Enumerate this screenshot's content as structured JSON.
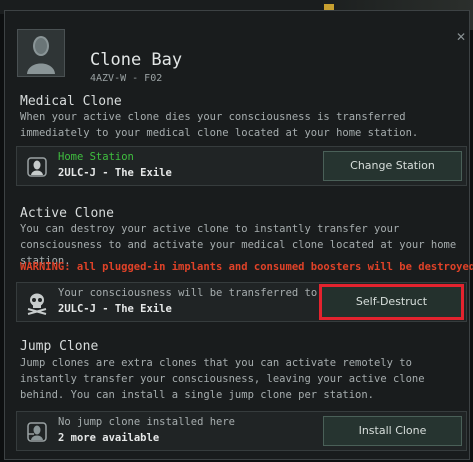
{
  "window": {
    "title": "Clone Bay",
    "subtitle": "4AZV-W - F02",
    "close_icon": "close-icon"
  },
  "medical": {
    "title": "Medical Clone",
    "description": "When your active clone dies your consciousness is transferred immediately to your medical clone located at your home station.",
    "home_label": "Home Station",
    "home_value": "2ULC-J - The Exile",
    "button": "Change Station",
    "accent": "#3fbf3f"
  },
  "active": {
    "title": "Active Clone",
    "description": "You can destroy your active clone to instantly transfer your consciousness to and activate your medical clone located at your home station.",
    "warning": "WARNING: all plugged-in implants and consumed boosters will be destroyed!",
    "line1": "Your consciousness will be transferred to",
    "line2": "2ULC-J - The Exile",
    "button": "Self-Destruct",
    "warning_color": "#e04228"
  },
  "jump": {
    "title": "Jump Clone",
    "description": "Jump clones are extra clones that you can activate remotely to instantly transfer your consciousness, leaving your active clone behind. You can install a single jump clone per station.",
    "line1": "No jump clone installed here",
    "line2": "2 more available",
    "button": "Install Clone"
  }
}
